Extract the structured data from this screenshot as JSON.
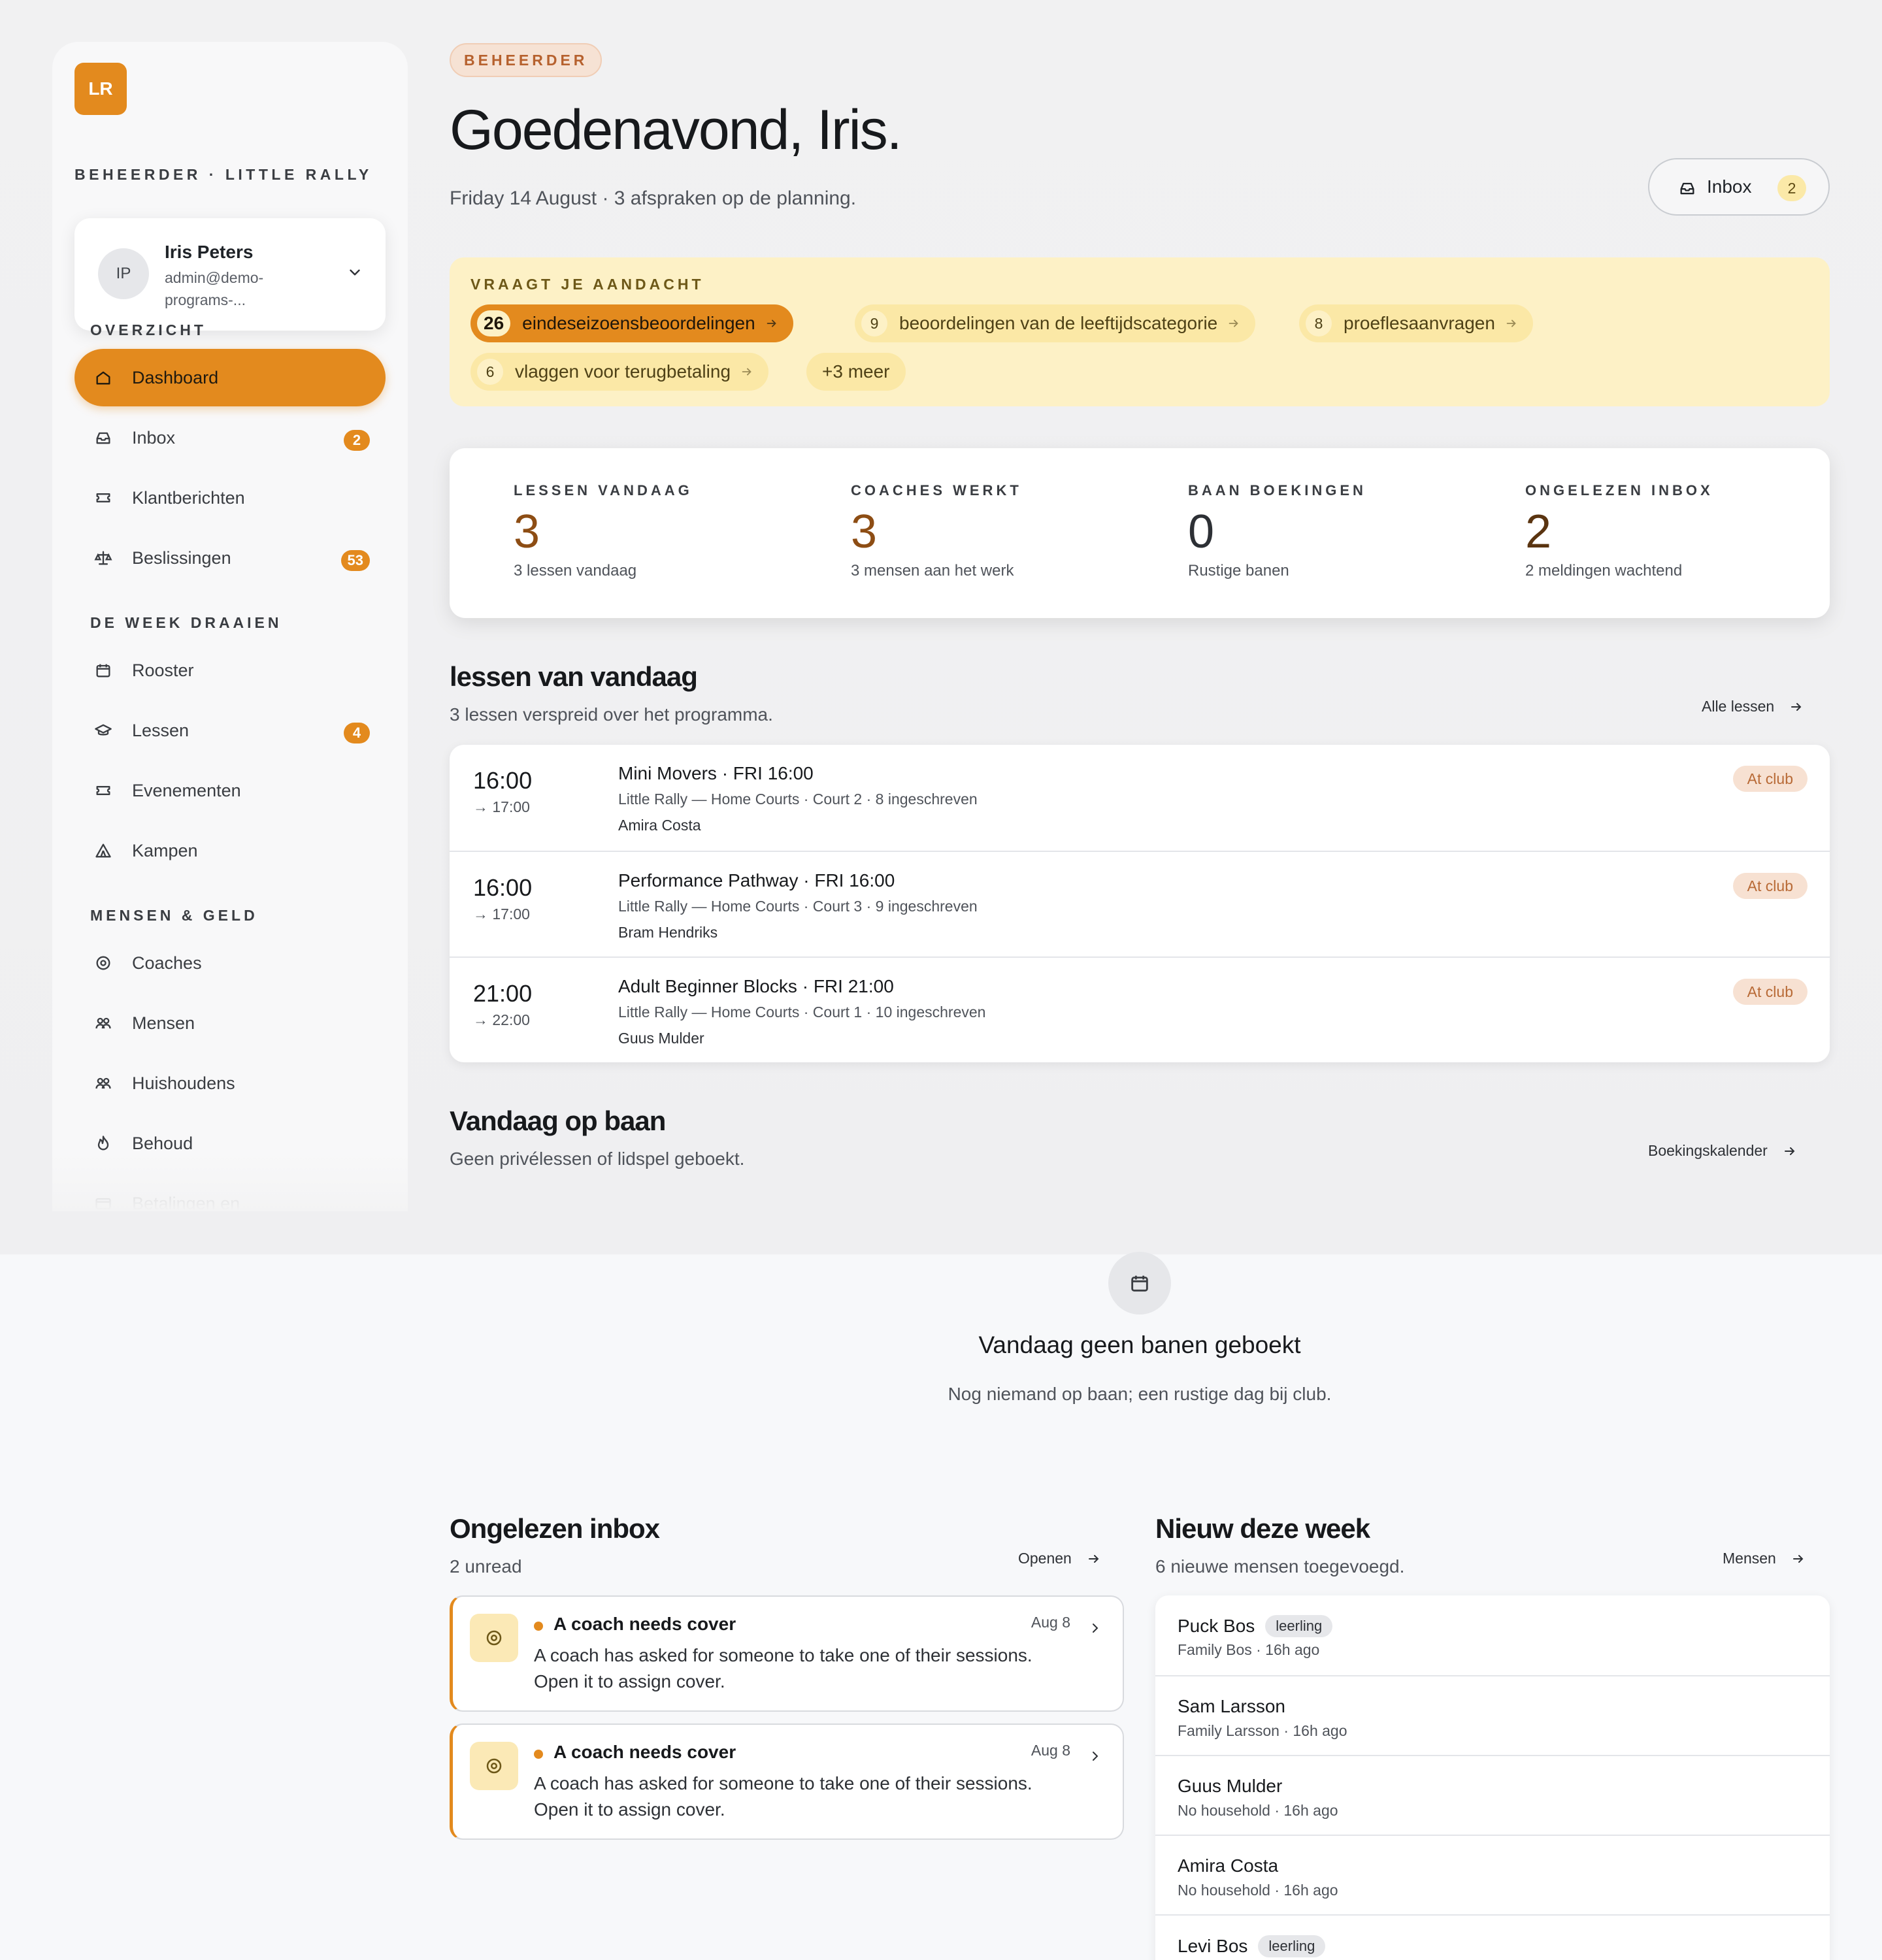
{
  "sidebar": {
    "logo": "LR",
    "brand": "BEHEERDER · LITTLE RALLY",
    "user": {
      "initials": "IP",
      "name": "Iris Peters",
      "email": "admin@demo-programs-..."
    },
    "sections": [
      {
        "title": "OVERZICHT",
        "items": [
          {
            "label": "Dashboard",
            "icon": "home-icon",
            "active": true
          },
          {
            "label": "Inbox",
            "icon": "inbox-icon",
            "badge": "2"
          },
          {
            "label": "Klantberichten",
            "icon": "ticket-icon"
          },
          {
            "label": "Beslissingen",
            "icon": "scale-icon",
            "badge": "53"
          }
        ]
      },
      {
        "title": "DE WEEK DRAAIEN",
        "items": [
          {
            "label": "Rooster",
            "icon": "calendar-icon"
          },
          {
            "label": "Lessen",
            "icon": "graduation-cap-icon",
            "badge": "4"
          },
          {
            "label": "Evenementen",
            "icon": "ticket-icon"
          },
          {
            "label": "Kampen",
            "icon": "tent-icon"
          }
        ]
      },
      {
        "title": "MENSEN & GELD",
        "items": [
          {
            "label": "Coaches",
            "icon": "target-icon"
          },
          {
            "label": "Mensen",
            "icon": "people-icon"
          },
          {
            "label": "Huishoudens",
            "icon": "people-icon"
          },
          {
            "label": "Behoud",
            "icon": "flame-icon"
          },
          {
            "label": "Betalingen en",
            "icon": "card-icon"
          }
        ]
      }
    ]
  },
  "header": {
    "role": "BEHEERDER",
    "greeting": "Goedenavond, Iris.",
    "subtitle": "Friday 14 August · 3 afspraken op de planning.",
    "inbox_label": "Inbox",
    "inbox_count": "2"
  },
  "attention": {
    "title": "VRAAGT JE AANDACHT",
    "chips": [
      {
        "count": "26",
        "label": "eindeseizoensbeoordelingen"
      },
      {
        "count": "9",
        "label": "beoordelingen van de leeftijdscategorie"
      },
      {
        "count": "8",
        "label": "proeflesaanvragen"
      },
      {
        "count": "6",
        "label": "vlaggen voor terugbetaling"
      }
    ],
    "more": "+3 meer"
  },
  "stats": [
    {
      "key": "LESSEN VANDAAG",
      "value": "3",
      "desc": "3 lessen vandaag"
    },
    {
      "key": "COACHES WERKT",
      "value": "3",
      "desc": "3 mensen aan het werk"
    },
    {
      "key": "BAAN BOEKINGEN",
      "value": "0",
      "desc": "Rustige banen"
    },
    {
      "key": "ONGELEZEN INBOX",
      "value": "2",
      "desc": "2 meldingen wachtend"
    }
  ],
  "lessons": {
    "title": "lessen van vandaag",
    "subtitle": "3 lessen verspreid over het programma.",
    "link": "Alle lessen",
    "rows": [
      {
        "start": "16:00",
        "end": "→ 17:00",
        "name": "Mini Movers",
        "when": " · FRI 16:00",
        "meta": "Little Rally — Home Courts · Court 2 · 8 ingeschreven",
        "coach": "Amira Costa",
        "tag": "At club"
      },
      {
        "start": "16:00",
        "end": "→ 17:00",
        "name": "Performance Pathway",
        "when": " · FRI 16:00",
        "meta": "Little Rally — Home Courts · Court 3 · 9 ingeschreven",
        "coach": "Bram Hendriks",
        "tag": "At club"
      },
      {
        "start": "21:00",
        "end": "→ 22:00",
        "name": "Adult Beginner Blocks",
        "when": " · FRI 21:00",
        "meta": "Little Rally — Home Courts · Court 1 · 10 ingeschreven",
        "coach": "Guus Mulder",
        "tag": "At club"
      }
    ]
  },
  "courts": {
    "title": "Vandaag op baan",
    "subtitle": "Geen privélessen of lidspel geboekt.",
    "link": "Boekingskalender",
    "empty_title": "Vandaag geen banen geboekt",
    "empty_desc": "Nog niemand op baan; een rustige dag bij club."
  },
  "unread": {
    "title": "Ongelezen inbox",
    "subtitle": "2 unread",
    "link": "Openen",
    "items": [
      {
        "title": "A coach needs cover",
        "date": "Aug 8",
        "body": "A coach has asked for someone to take one of their sessions. Open it to assign cover."
      },
      {
        "title": "A coach needs cover",
        "date": "Aug 8",
        "body": "A coach has asked for someone to take one of their sessions. Open it to assign cover."
      }
    ]
  },
  "newweek": {
    "title": "Nieuw deze week",
    "subtitle": "6 nieuwe mensen toegevoegd.",
    "link": "Mensen",
    "people": [
      {
        "name": "Puck Bos",
        "label": "leerling",
        "sub": "Family Bos · 16h ago"
      },
      {
        "name": "Sam Larsson",
        "label": "",
        "sub": "Family Larsson · 16h ago"
      },
      {
        "name": "Guus Mulder",
        "label": "",
        "sub": "No household · 16h ago"
      },
      {
        "name": "Amira Costa",
        "label": "",
        "sub": "No household · 16h ago"
      },
      {
        "name": "Levi Bos",
        "label": "leerling",
        "sub": ""
      }
    ]
  },
  "colors": {
    "accent": "#e38a1e",
    "attention_bg": "#fdf1c6",
    "tag_bg": "#f7e1d2"
  }
}
